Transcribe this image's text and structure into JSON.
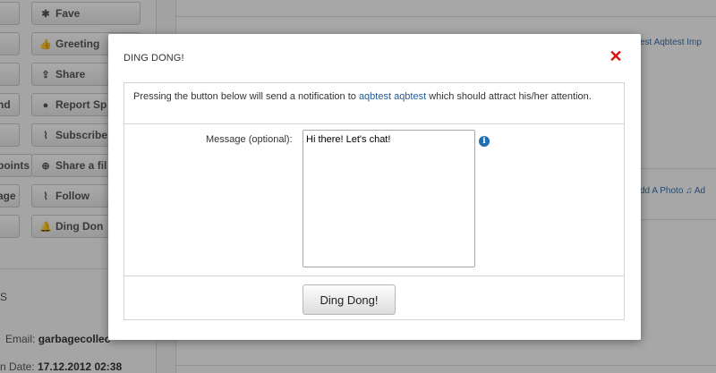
{
  "background": {
    "sidebar_buttons": [
      {
        "label": "Fave",
        "icon": "asterisk-icon",
        "glyph": "✱"
      },
      {
        "label": "Greeting",
        "icon": "thumbs-up-icon",
        "glyph": "👍"
      },
      {
        "label": "Share",
        "icon": "share-icon",
        "glyph": "⇪"
      },
      {
        "label": "Report Sp",
        "icon": "alert-icon",
        "glyph": "●"
      },
      {
        "label": "Subscribe",
        "icon": "paperclip-icon",
        "glyph": "⌇"
      },
      {
        "label": "Share a fil",
        "icon": "download-icon",
        "glyph": "⊕"
      },
      {
        "label": "Follow",
        "icon": "paperclip-icon",
        "glyph": "⌇"
      },
      {
        "label": "Ding Don",
        "icon": "bell-icon",
        "glyph": "🔔"
      }
    ],
    "partial_buttons": [
      "nd",
      "points",
      "age"
    ],
    "section_label": "S",
    "email_label": "Email:",
    "email_value": "garbagecollec",
    "date_label": "n Date:",
    "date_value": "17.12.2012 02:38",
    "links_top": "est Aqbtest   Imp",
    "links_mid": "dd A Photo   ♫ Ad"
  },
  "dialog": {
    "title": "DING DONG!",
    "close_glyph": "✕",
    "notice_prefix": "Pressing the button below will send a notification to ",
    "notice_user": "aqbtest aqbtest",
    "notice_suffix": " which should attract his/her attention.",
    "message_label": "Message (optional):",
    "message_value": "Hi there! Let's chat!",
    "info_glyph": "i",
    "submit_label": "Ding Dong!"
  }
}
